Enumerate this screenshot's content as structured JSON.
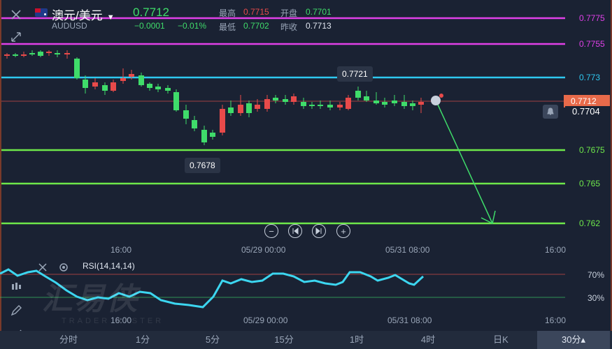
{
  "header": {
    "symbol_name": "澳元/美元",
    "symbol_code": "AUDUSD",
    "price": "0.7712",
    "change": "−0.0001",
    "change_pct": "−0.01%",
    "high_label": "最高",
    "high_value": "0.7715",
    "open_label": "开盘",
    "open_value": "0.7701",
    "low_label": "最低",
    "low_value": "0.7702",
    "prev_close_label": "昨收",
    "prev_close_value": "0.7713"
  },
  "price_levels": [
    {
      "label": "0.7775",
      "color": "#e040e8"
    },
    {
      "label": "0.7755",
      "color": "#e040e8"
    },
    {
      "label": "0.773",
      "color": "#2ec8f0"
    },
    {
      "label": "0.7675",
      "color": "#6ee84a"
    },
    {
      "label": "0.765",
      "color": "#6ee84a"
    },
    {
      "label": "0.762",
      "color": "#6ee84a"
    }
  ],
  "current_price_tag": "0.7712",
  "bell_price": "0.7704",
  "tooltips": {
    "high_point": "0.7721",
    "low_point": "0.7678"
  },
  "time_axis": [
    "16:00",
    "05/29 00:00",
    "05/31 08:00",
    "16:00"
  ],
  "rsi": {
    "label": "RSI(14,14,14)",
    "upper": "70%",
    "lower": "30%"
  },
  "watermark": {
    "main": "汇易侠",
    "sub": "TRADER MASTER"
  },
  "tabs": [
    "分时",
    "1分",
    "5分",
    "15分",
    "1时",
    "4时",
    "日K",
    "30分▴"
  ],
  "active_tab": "30分▴",
  "colors": {
    "up": "#e84a4a",
    "down": "#3fdc6a",
    "rsi": "#3cd6f0",
    "bg": "#1a2233"
  }
}
